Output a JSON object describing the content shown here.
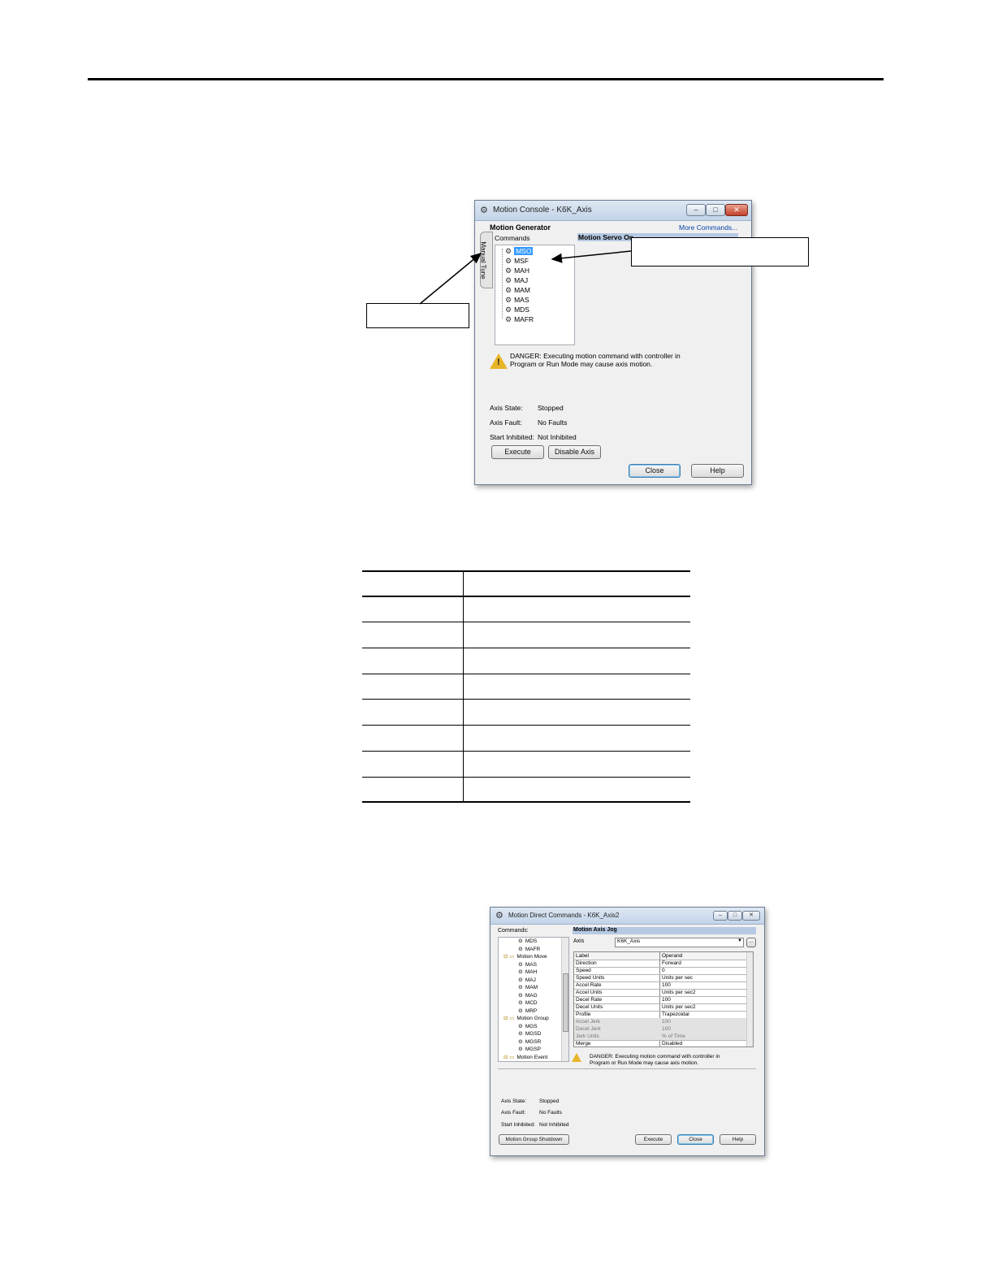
{
  "dialog1": {
    "title": "Motion Console - K6K_Axis",
    "section_title": "Motion Generator",
    "more_commands": "More Commands...",
    "commands_label": "Commands",
    "servo_header": "Motion Servo On",
    "side_tab": "Manual Tune",
    "tree_items": [
      "MSO",
      "MSF",
      "MAH",
      "MAJ",
      "MAM",
      "MAS",
      "MDS",
      "MAFR"
    ],
    "danger_text_1": "DANGER: Executing motion command with controller in",
    "danger_text_2": "Program or Run Mode may cause axis motion.",
    "status": {
      "axis_state_label": "Axis State:",
      "axis_state_value": "Stopped",
      "axis_fault_label": "Axis Fault:",
      "axis_fault_value": "No Faults",
      "start_inhibited_label": "Start Inhibited:",
      "start_inhibited_value": "Not Inhibited"
    },
    "buttons": {
      "execute": "Execute",
      "disable_axis": "Disable Axis",
      "close": "Close",
      "help": "Help"
    }
  },
  "dialog2": {
    "title": "Motion Direct Commands - K6K_Axis2",
    "commands_label": "Commands:",
    "panel_title": "Motion Axis Jog",
    "axis_label": "Axis",
    "axis_value": "K6K_Axis",
    "tree_items": [
      {
        "label": "MDS",
        "folder": false
      },
      {
        "label": "MAFR",
        "folder": false
      },
      {
        "label": "Motion Move",
        "folder": true
      },
      {
        "label": "MAS",
        "folder": false
      },
      {
        "label": "MAH",
        "folder": false
      },
      {
        "label": "MAJ",
        "folder": false
      },
      {
        "label": "MAM",
        "folder": false
      },
      {
        "label": "MAG",
        "folder": false
      },
      {
        "label": "MCD",
        "folder": false
      },
      {
        "label": "MRP",
        "folder": false
      },
      {
        "label": "Motion Group",
        "folder": true
      },
      {
        "label": "MGS",
        "folder": false
      },
      {
        "label": "MGSD",
        "folder": false
      },
      {
        "label": "MGSR",
        "folder": false
      },
      {
        "label": "MGSP",
        "folder": false
      },
      {
        "label": "Motion Event",
        "folder": true
      }
    ],
    "grid_header": [
      "Label",
      "Operand"
    ],
    "grid_rows": [
      {
        "label": "Direction",
        "operand": "Forward",
        "dim": false
      },
      {
        "label": "Speed",
        "operand": "0",
        "dim": false
      },
      {
        "label": "Speed Units",
        "operand": "Units per sec",
        "dim": false
      },
      {
        "label": "Accel Rate",
        "operand": "100",
        "dim": false
      },
      {
        "label": "Accel Units",
        "operand": "Units per sec2",
        "dim": false
      },
      {
        "label": "Decel Rate",
        "operand": "100",
        "dim": false
      },
      {
        "label": "Decel Units",
        "operand": "Units per sec2",
        "dim": false
      },
      {
        "label": "Profile",
        "operand": "Trapezoidal",
        "dim": false
      },
      {
        "label": "Accel Jerk",
        "operand": "100",
        "dim": true
      },
      {
        "label": "Decel Jerk",
        "operand": "100",
        "dim": true
      },
      {
        "label": "Jerk Units",
        "operand": "% of Time",
        "dim": true
      },
      {
        "label": "Merge",
        "operand": "Disabled",
        "dim": false
      }
    ],
    "danger_text_1": "DANGER: Executing motion command with controller in",
    "danger_text_2": "Program or Run Mode may cause axis motion.",
    "status": {
      "axis_state_label": "Axis State:",
      "axis_state_value": "Stopped",
      "axis_fault_label": "Axis Fault:",
      "axis_fault_value": "No Faults",
      "start_inhibited_label": "Start Inhibited:",
      "start_inhibited_value": "Not Inhibited"
    },
    "buttons": {
      "group_shutdown": "Motion Group Shutdown",
      "execute": "Execute",
      "close": "Close",
      "help": "Help"
    }
  },
  "colors": {
    "selection": "#3399ff",
    "warning": "#e8b52a",
    "titlebar": "#c2d3e8"
  },
  "icons": {
    "command": "gear-icon",
    "folder": "folder-icon",
    "warning": "warning-icon"
  }
}
